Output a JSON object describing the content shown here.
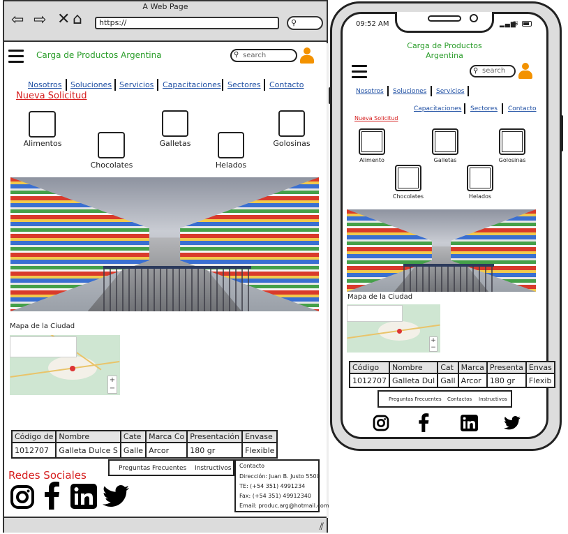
{
  "desktop": {
    "window_title": "A Web Page",
    "url": "https://",
    "brand": "Carga de Productos Argentina",
    "search_placeholder": "search",
    "nav": [
      "Nosotros",
      "Soluciones",
      "Servicios",
      "Capacitaciones",
      "Sectores",
      "Contacto"
    ],
    "new_request": "Nueva Solicitud",
    "categories": [
      "Alimentos",
      "Chocolates",
      "Galletas",
      "Helados",
      "Golosinas"
    ],
    "map_title": "Mapa de la Ciudad",
    "table": {
      "headers": [
        "Código de",
        "Nombre",
        "Cate",
        "Marca Co",
        "Presentación",
        "Envase"
      ],
      "row": [
        "1012707",
        "Galleta Dulce S",
        "Galle",
        "Arcor",
        "180 gr",
        "Flexible"
      ]
    },
    "social_title": "Redes Sociales",
    "footer_links": [
      "Preguntas Frecuentes",
      "Instructivos"
    ],
    "contact": {
      "title": "Contacto",
      "address": "Dirección: Juan B. Justo 5500",
      "phone": "TE: (+54 351) 4991234",
      "fax": "Fax: (+54 351) 49912340",
      "email": "Email: produc.arg@hotmail.com"
    },
    "social_icons": [
      "instagram-icon",
      "facebook-icon",
      "linkedin-icon",
      "twitter-icon"
    ]
  },
  "mobile": {
    "time": "09:52 AM",
    "brand_line1": "Carga de Productos",
    "brand_line2": "Argentina",
    "search_placeholder": "search",
    "nav": [
      "Nosotros",
      "Soluciones",
      "Servicios",
      "Capacitaciones",
      "Sectores",
      "Contacto"
    ],
    "new_request": "Nueva Solicitud",
    "categories": [
      "Alimento",
      "Galletas",
      "Golosinas",
      "Chocolates",
      "Helados"
    ],
    "map_title": "Mapa de la Ciudad",
    "table": {
      "headers": [
        "Código",
        "Nombre",
        "Cat",
        "Marca",
        "Presenta",
        "Envas"
      ],
      "row": [
        "1012707",
        "Galleta Dul",
        "Gall",
        "Arcor",
        "180 gr",
        "Flexib"
      ]
    },
    "footer_links": [
      "Preguntas Frecuentes",
      "Contactos",
      "Instructivos"
    ]
  },
  "colors": {
    "brand_green": "#2a9d2a",
    "link_blue": "#1f4fa3",
    "red": "#d61e1e",
    "user_orange": "#f39200"
  }
}
